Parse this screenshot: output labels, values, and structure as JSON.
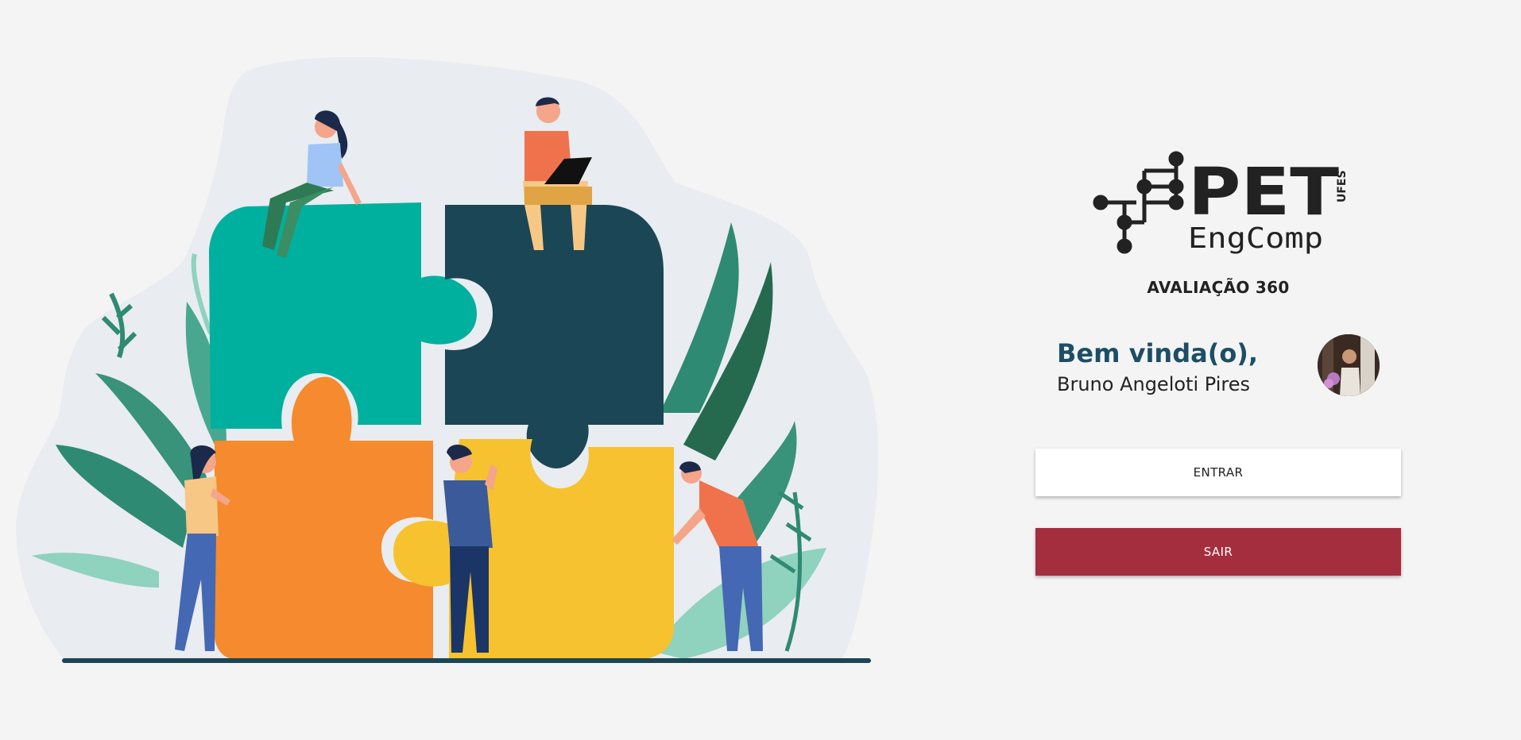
{
  "brand": {
    "logo_main": "PET",
    "logo_sub": "EngComp",
    "logo_tag": "UFES"
  },
  "app": {
    "subtitle": "AVALIAÇÃO 360"
  },
  "welcome": {
    "greeting": "Bem vinda(o),",
    "user_name": "Bruno Angeloti Pires",
    "avatar_icon": "user-photo-icon"
  },
  "actions": {
    "enter_label": "ENTRAR",
    "exit_label": "SAIR"
  },
  "colors": {
    "background": "#f4f4f4",
    "greeting": "#1c4e66",
    "exit_button": "#a42e3e",
    "enter_button": "#ffffff",
    "puzzle_teal": "#00b09e",
    "puzzle_dark": "#1b4655",
    "puzzle_orange": "#f58a2e",
    "puzzle_yellow": "#f6c22f"
  }
}
